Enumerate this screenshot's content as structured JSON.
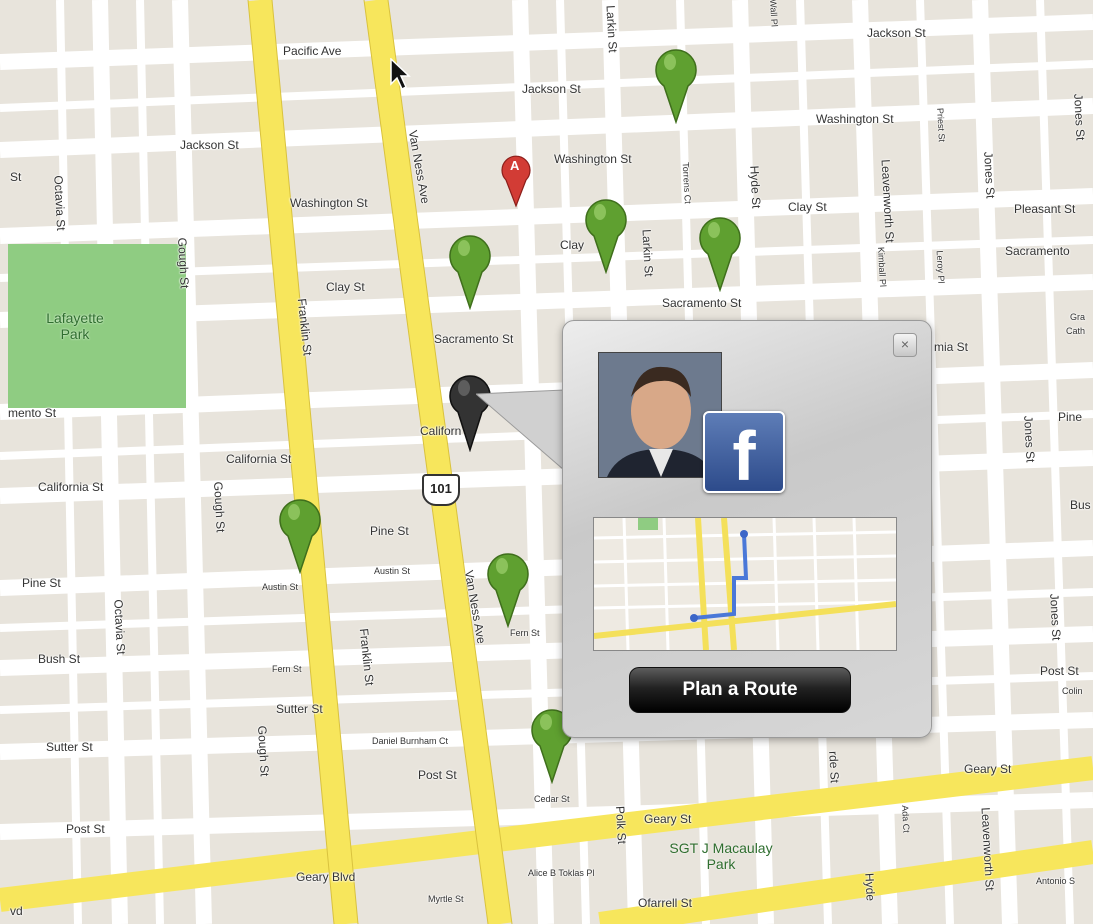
{
  "map": {
    "streets": [
      "Pacific Ave",
      "Jackson St",
      "Jackson St",
      "Jackson St",
      "Washington St",
      "Washington St",
      "Washington St",
      "Clay St",
      "Clay St",
      "Clay",
      "Sacramento St",
      "Sacramento St",
      "Sacramento",
      "mento St",
      "mia St",
      "California St",
      "California St",
      "Californ",
      "Pine St",
      "Pine St",
      "Pine",
      "Bush St",
      "Bus",
      "Sutter St",
      "Sutter St",
      "Post St",
      "Post St",
      "Post St",
      "Geary Blvd",
      "Geary St",
      "Geary St",
      "Ofarrell St",
      "Van Ness Ave",
      "Van Ness Ave",
      "Franklin St",
      "Franklin St",
      "Gough St",
      "Gough St",
      "Gough St",
      "Octavia St",
      "Octavia St",
      "Polk St",
      "Larkin St",
      "Larkin St",
      "Hyde St",
      "Hyde",
      "Leavenworth St",
      "Leavenworth St",
      "Jones St",
      "Jones St",
      "Jones St",
      "Jones St",
      "Pleasant St",
      "Austin St",
      "Austin St",
      "Fern St",
      "Fern St",
      "Daniel Burnham Ct",
      "Cedar St",
      "Myrtle St",
      "Alice B Toklas Pl",
      "Torrens Ct",
      "Kimball Pl",
      "Leroy Pl",
      "Ada Ct",
      "Antonio S",
      "Wall Pl",
      "Priest St",
      "Colin",
      "Gra",
      "Cath",
      "St",
      "vd",
      "rde St"
    ],
    "parks": [
      "Lafayette Park",
      "SGT J Macaulay Park"
    ],
    "highway_shield": "101",
    "marker_a_label": "A"
  },
  "popup": {
    "badge_letter": "f",
    "close_symbol": "×",
    "plan_route_label": "Plan a Route"
  },
  "colors": {
    "major_road": "#f7e65c",
    "minor_road": "#ffffff",
    "park": "#8fcc82",
    "block": "#e8e4dc",
    "green_pin": "#5fa030",
    "selected_pin": "#333333",
    "marker_a": "#d23c35"
  }
}
